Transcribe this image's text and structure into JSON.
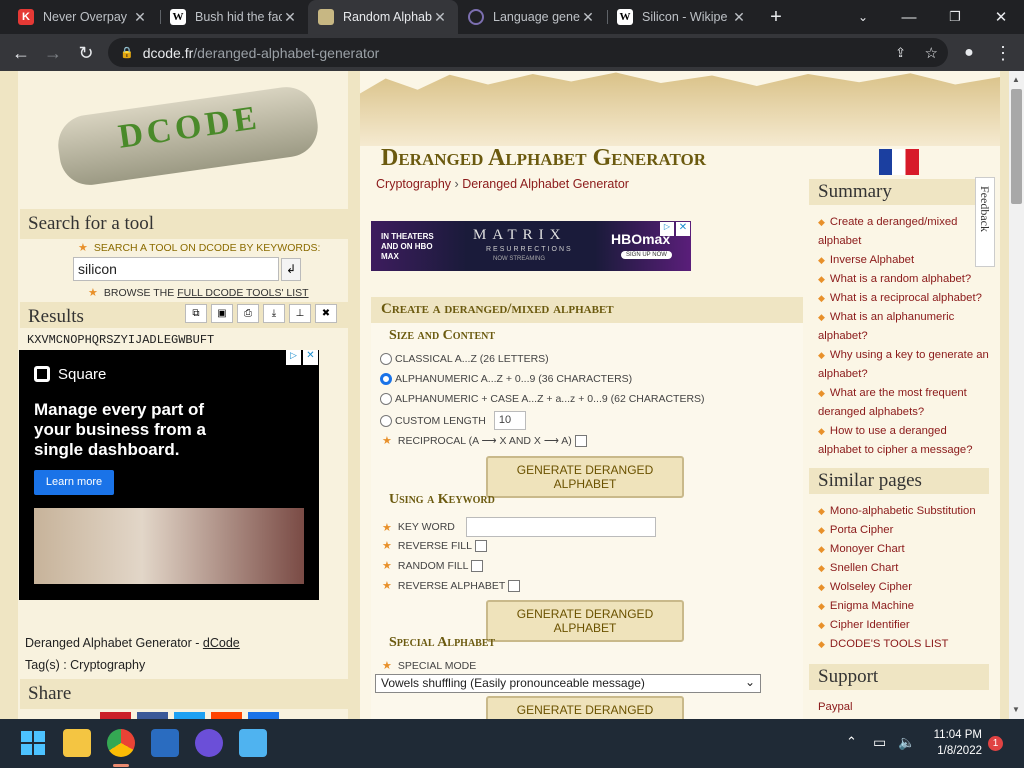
{
  "browser": {
    "tabs": [
      {
        "title": "Never Overpay",
        "favicon": "K"
      },
      {
        "title": "Bush hid the fac",
        "favicon": "W"
      },
      {
        "title": "Random Alphab",
        "favicon": "dcode"
      },
      {
        "title": "Language gene",
        "favicon": "globe"
      },
      {
        "title": "Silicon - Wikipe",
        "favicon": "W"
      }
    ],
    "url_host": "dcode.fr",
    "url_path": "/deranged-alphabet-generator"
  },
  "left": {
    "logo_text": "DCODE",
    "search_heading": "Search for a tool",
    "search_hint": "SEARCH A TOOL ON DCODE BY KEYWORDS:",
    "search_value": "silicon",
    "browse_prefix": "BROWSE THE",
    "browse_link": "FULL DCODE TOOLS' LIST",
    "results_heading": "Results",
    "result_text": "KXVMCNOPHQRSZYIJADLEGWBUFT",
    "ad": {
      "brand": "Square",
      "headline": "Manage every part of your business from a single dashboard.",
      "cta": "Learn more"
    },
    "footer_title": "Deranged Alphabet Generator - ",
    "footer_link": "dCode",
    "tags_label": "Tag(s) : ",
    "tags_value": "Cryptography",
    "share_heading": "Share"
  },
  "main": {
    "title": "Deranged Alphabet Generator",
    "breadcrumb_1": "Cryptography",
    "breadcrumb_sep": "›",
    "breadcrumb_2": "Deranged Alphabet Generator",
    "banner": {
      "left": "IN THEATERS AND ON HBO MAX",
      "center": "MATRIX",
      "center_sub": "RESURRECTIONS",
      "center_sub2": "NOW STREAMING",
      "brand": "HBOmax",
      "cta": "SIGN UP NOW"
    },
    "section_title": "Create a deranged/mixed alphabet",
    "size_heading": "Size and Content",
    "opt_classical": "CLASSICAL A...Z (26 LETTERS)",
    "opt_alnum": "ALPHANUMERIC A...Z + 0...9 (36 CHARACTERS)",
    "opt_alnum_case": "ALPHANUMERIC + CASE A...Z + a...z + 0...9 (62 CHARACTERS)",
    "opt_custom": "CUSTOM LENGTH",
    "custom_length_value": "10",
    "opt_reciprocal": "RECIPROCAL (A ⟶ X AND X ⟶ A)",
    "generate_label": "GENERATE DERANGED ALPHABET",
    "keyword_heading": "Using a Keyword",
    "keyword_label": "KEY WORD",
    "reverse_fill": "REVERSE FILL",
    "random_fill": "RANDOM FILL",
    "reverse_alphabet": "REVERSE ALPHABET",
    "special_heading": "Special Alphabet",
    "special_mode_label": "SPECIAL MODE",
    "special_mode_value": "Vowels shuffling (Easily pronounceable message)"
  },
  "right": {
    "summary_heading": "Summary",
    "summary_items": [
      "Create a deranged/mixed alphabet",
      "Inverse Alphabet",
      "What is a random alphabet?",
      "What is a reciprocal alphabet?",
      "What is an alphanumeric alphabet?",
      "Why using a key to generate an alphabet?",
      "What are the most frequent deranged alphabets?",
      "How to use a deranged alphabet to cipher a message?"
    ],
    "similar_heading": "Similar pages",
    "similar_items": [
      "Mono-alphabetic Substitution",
      "Porta Cipher",
      "Monoyer Chart",
      "Snellen Chart",
      "Wolseley Cipher",
      "Enigma Machine",
      "Cipher Identifier",
      "DCODE'S TOOLS LIST"
    ],
    "support_heading": "Support",
    "support_item": "Paypal",
    "feedback": "Feedback"
  },
  "taskbar": {
    "time": "11:04 PM",
    "date": "1/8/2022",
    "notif_count": "1"
  }
}
